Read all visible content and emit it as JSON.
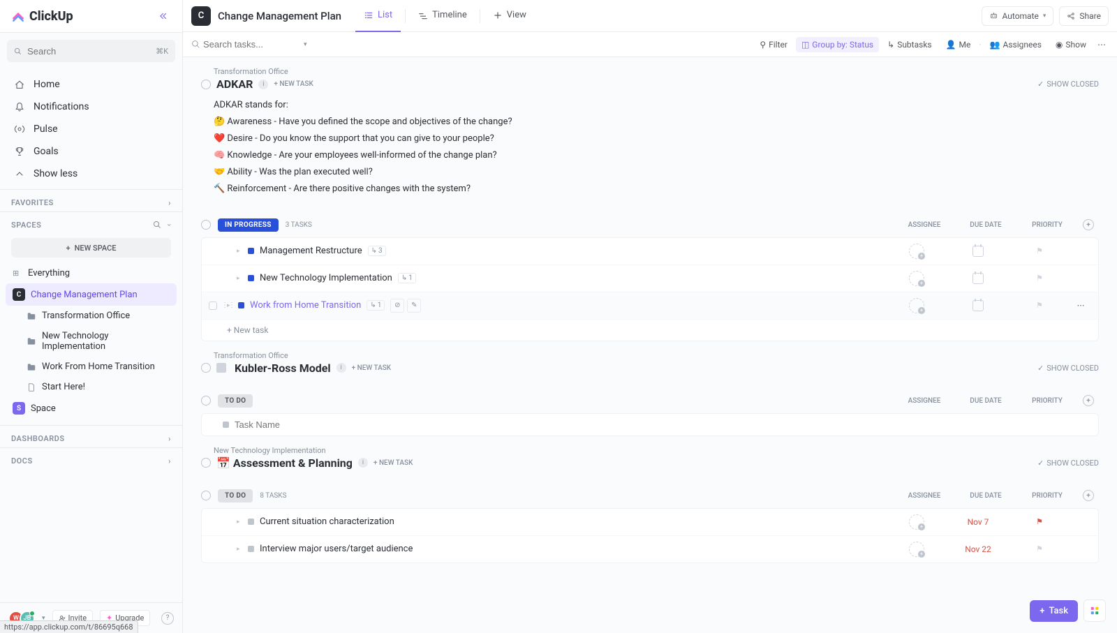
{
  "logo": {
    "text": "ClickUp"
  },
  "sidebar": {
    "search_placeholder": "Search",
    "search_kbd": "⌘K",
    "nav": [
      {
        "icon": "home",
        "label": "Home"
      },
      {
        "icon": "bell",
        "label": "Notifications"
      },
      {
        "icon": "pulse",
        "label": "Pulse"
      },
      {
        "icon": "trophy",
        "label": "Goals"
      },
      {
        "icon": "chev-up",
        "label": "Show less"
      }
    ],
    "favorites_label": "FAVORITES",
    "spaces_label": "SPACES",
    "new_space_label": "NEW SPACE",
    "spaces": [
      {
        "icon": "grid",
        "label": "Everything"
      },
      {
        "badge": "C",
        "badge_color": "black",
        "label": "Change Management Plan",
        "active": true
      },
      {
        "child": true,
        "icon": "folder",
        "label": "Transformation Office"
      },
      {
        "child": true,
        "icon": "folder",
        "label": "New Technology Implementation"
      },
      {
        "child": true,
        "icon": "folder",
        "label": "Work From Home Transition"
      },
      {
        "child": true,
        "icon": "doc",
        "label": "Start Here!"
      },
      {
        "badge": "S",
        "badge_color": "purple",
        "label": "Space"
      }
    ],
    "dashboards_label": "DASHBOARDS",
    "docs_label": "DOCS",
    "avatars": [
      {
        "text": "W",
        "color": "#e04f44"
      },
      {
        "text": "JB",
        "color": "#5bbcb2",
        "online": true
      }
    ],
    "invite_label": "Invite",
    "upgrade_label": "Upgrade"
  },
  "topbar": {
    "badge": "C",
    "title": "Change Management Plan",
    "tabs": [
      {
        "icon": "list",
        "label": "List",
        "active": true
      },
      {
        "icon": "timeline",
        "label": "Timeline"
      },
      {
        "icon": "plus",
        "label": "View"
      }
    ],
    "automate_label": "Automate",
    "share_label": "Share"
  },
  "filterbar": {
    "search_placeholder": "Search tasks...",
    "filter_label": "Filter",
    "groupby_label": "Group by: Status",
    "subtasks_label": "Subtasks",
    "me_label": "Me",
    "assignees_label": "Assignees",
    "show_label": "Show"
  },
  "columns": {
    "assignee": "ASSIGNEE",
    "due_date": "DUE DATE",
    "priority": "PRIORITY"
  },
  "lists": [
    {
      "path": "Transformation Office",
      "title": "ADKAR",
      "new_task": "+ NEW TASK",
      "show_closed": "SHOW CLOSED",
      "desc": [
        "ADKAR stands for:",
        "🤔 Awareness - Have you defined the scope and objectives of the change?",
        "❤️ Desire - Do you know the support that you can give to your people?",
        "🧠 Knowledge - Are your employees well-informed of the change plan?",
        "🤝 Ability - Was the plan executed well?",
        "🔨 Reinforcement - Are there positive changes with the system?"
      ],
      "groups": [
        {
          "status": "IN PROGRESS",
          "status_class": "progress",
          "count": "3 TASKS",
          "tasks": [
            {
              "name": "Management Restructure",
              "status": "blue",
              "sub": "3"
            },
            {
              "name": "New Technology Implementation",
              "status": "blue",
              "sub": "1"
            },
            {
              "name": "Work from Home Transition",
              "status": "blue",
              "sub": "1",
              "link": true,
              "hover": true
            }
          ],
          "new_task_row": "+ New task"
        }
      ]
    },
    {
      "path": "Transformation Office",
      "title": "Kubler-Ross Model",
      "title_prefix_grey_box": true,
      "new_task": "+ NEW TASK",
      "show_closed": "SHOW CLOSED",
      "groups": [
        {
          "status": "TO DO",
          "status_class": "todo",
          "count": "",
          "tasks": [],
          "placeholder_row": "Task Name"
        }
      ]
    },
    {
      "path": "New Technology Implementation",
      "title": "📅 Assessment & Planning",
      "new_task": "+ NEW TASK",
      "show_closed": "SHOW CLOSED",
      "groups": [
        {
          "status": "TO DO",
          "status_class": "todo",
          "count": "8 TASKS",
          "tasks": [
            {
              "name": "Current situation characterization",
              "status": "grey",
              "due": "Nov 7",
              "priority": "red"
            },
            {
              "name": "Interview major users/target audience",
              "status": "grey",
              "due": "Nov 22"
            }
          ]
        }
      ]
    }
  ],
  "fab": {
    "task": "Task"
  },
  "status_url": "https://app.clickup.com/t/86695q668"
}
